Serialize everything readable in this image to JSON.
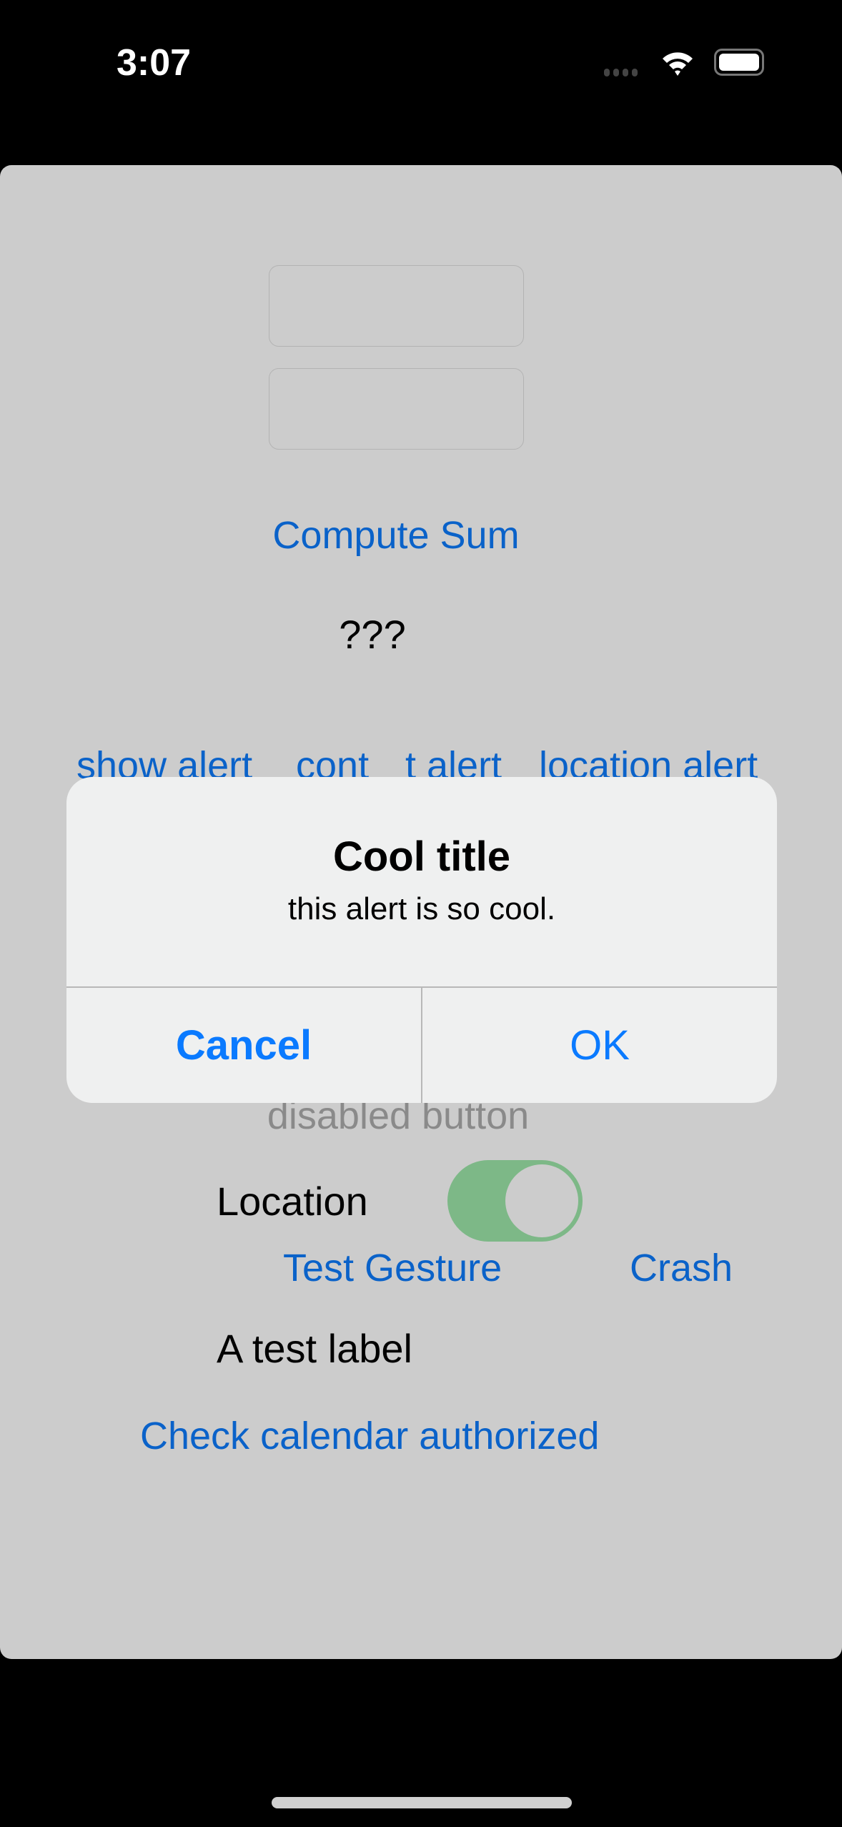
{
  "status_bar": {
    "time": "3:07",
    "wifi_icon": "wifi-icon",
    "battery_icon": "battery-icon",
    "signal_icon": "signal-dots-icon"
  },
  "main": {
    "field1_value": "",
    "field2_value": "",
    "compute_sum": "Compute Sum",
    "result": "???",
    "alert_buttons": [
      "show alert",
      "cont",
      "t alert",
      "location alert"
    ],
    "disabled_button": "disabled button",
    "location_label": "Location",
    "location_toggle_on": true,
    "test_gesture": "Test Gesture",
    "crash": "Crash",
    "test_label": "A test label",
    "check_calendar": "Check calendar authorized"
  },
  "alert": {
    "title": "Cool title",
    "message": "this alert is so cool.",
    "cancel": "Cancel",
    "ok": "OK"
  },
  "colors": {
    "accent": "#0a7aff",
    "toggle_on": "#7db887",
    "dim_background": "#cccccc",
    "alert_bg": "#eff0f0"
  }
}
